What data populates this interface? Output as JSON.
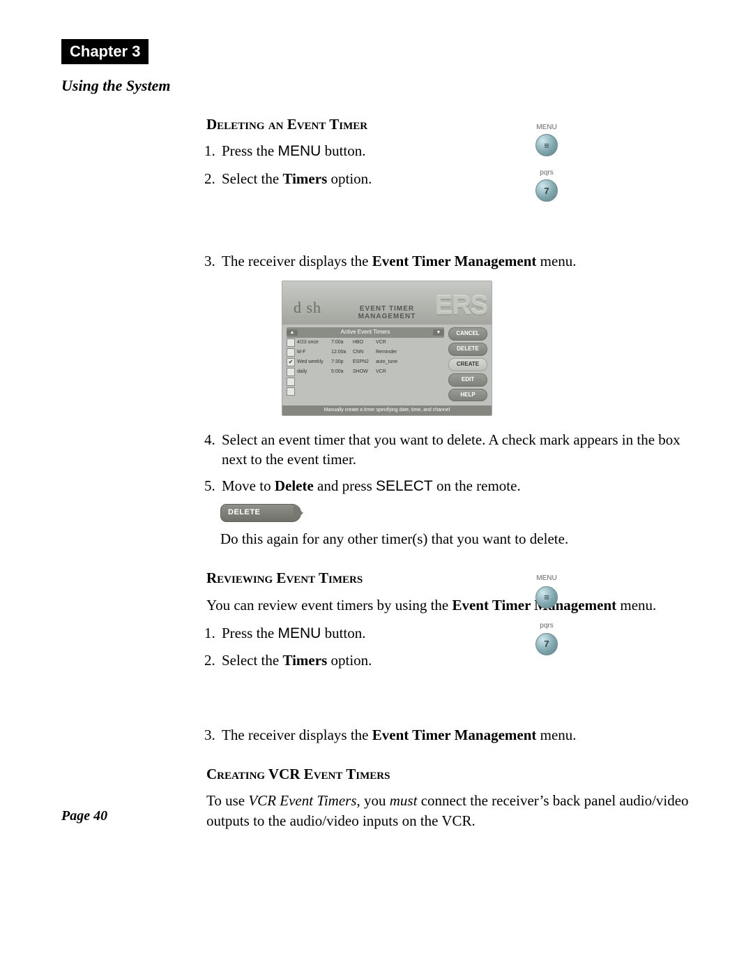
{
  "header": {
    "chapter_label": "Chapter 3",
    "subtitle": "Using the System"
  },
  "remote_icons": {
    "menu_label": "MENU",
    "menu_glyph": "≡",
    "pqrs_label": "pqrs",
    "seven": "7"
  },
  "section1": {
    "heading": "Deleting an Event Timer",
    "step1_pre": "Press the ",
    "step1_btn": "MENU",
    "step1_post": " button.",
    "step2_pre": "Select the ",
    "step2_bold": "Timers",
    "step2_post": " option.",
    "step3_pre": "The receiver displays the ",
    "step3_bold": "Event Timer Management",
    "step3_post": " menu.",
    "step4": "Select an event timer that you want to delete. A check mark appears in the box next to the event timer.",
    "step5_pre": "Move to ",
    "step5_bold": "Delete",
    "step5_mid": " and press ",
    "step5_btn": "SELECT",
    "step5_post": " on the remote.",
    "followup": "Do this again for any other timer(s) that you want to delete."
  },
  "screenshot": {
    "logo": "d sh",
    "logo_accent": "’",
    "title_line1": "EVENT TIMER",
    "title_line2": "MANAGEMENT",
    "banner_word": "ERS",
    "table_header": "Active Event Timers",
    "rows": [
      {
        "checked": false,
        "c1": "4/23   once",
        "c2": "7:00a",
        "c3": "HBO",
        "c4": "VCR"
      },
      {
        "checked": false,
        "c1": "M-F",
        "c2": "12:00a",
        "c3": "CNN",
        "c4": "Reminder"
      },
      {
        "checked": true,
        "c1": "Wed weekly",
        "c2": "7:30p",
        "c3": "ESPN2",
        "c4": "auto_tune"
      },
      {
        "checked": false,
        "c1": "daily",
        "c2": "5:00a",
        "c3": "SHOW",
        "c4": "VCR"
      }
    ],
    "buttons": [
      "CANCEL",
      "DELETE",
      "CREATE",
      "EDIT",
      "HELP"
    ],
    "footer": "Manually create a timer specifying date, time, and channel"
  },
  "delete_pill": "DELETE",
  "section2": {
    "heading": "Reviewing Event Timers",
    "intro_pre": "You can review event timers by using the ",
    "intro_bold": "Event Timer Management",
    "intro_post": " menu.",
    "step1_pre": "Press the ",
    "step1_btn": "MENU",
    "step1_post": " button.",
    "step2_pre": "Select the ",
    "step2_bold": "Timers",
    "step2_post": " option.",
    "step3_pre": "The receiver displays the ",
    "step3_bold": "Event Timer Management",
    "step3_post": " menu."
  },
  "section3": {
    "heading": "Creating VCR Event Timers",
    "para_pre": "To use ",
    "para_ital": "VCR Event Timers",
    "para_mid": ", you ",
    "para_ital2": "must",
    "para_post": " connect the receiver’s back panel audio/video outputs to the audio/video inputs on the VCR."
  },
  "page_number": "Page 40"
}
